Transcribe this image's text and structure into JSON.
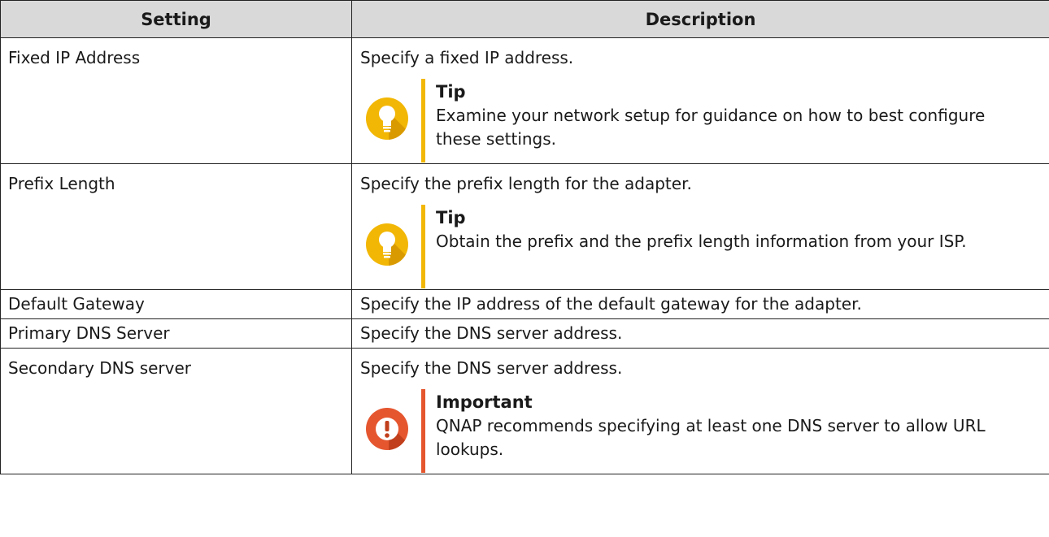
{
  "headers": {
    "setting": "Setting",
    "description": "Description"
  },
  "rows": [
    {
      "setting": "Fixed IP Address",
      "description": "Specify a fixed IP address.",
      "note": {
        "type": "tip",
        "title": "Tip",
        "text": "Examine your network setup for guidance on how to best configure these settings."
      }
    },
    {
      "setting": "Prefix Length",
      "description": "Specify the prefix length for the adapter.",
      "note": {
        "type": "tip",
        "title": "Tip",
        "text": "Obtain the prefix and the prefix length information from your ISP."
      }
    },
    {
      "setting": "Default Gateway",
      "description": "Specify the IP address of the default gateway for the adapter."
    },
    {
      "setting": "Primary DNS Server",
      "description": "Specify the DNS server address."
    },
    {
      "setting": "Secondary DNS server",
      "description": "Specify the DNS server address.",
      "note": {
        "type": "important",
        "title": "Important",
        "text": "QNAP recommends specifying at least one DNS server to allow URL lookups."
      }
    }
  ],
  "icons": {
    "tip": "lightbulb-icon",
    "important": "exclamation-icon"
  },
  "colors": {
    "header_bg": "#d9d9d9",
    "tip_accent": "#f2b705",
    "tip_shadow": "#d99a00",
    "important_accent": "#e5562f",
    "important_shadow": "#c13f1c"
  }
}
